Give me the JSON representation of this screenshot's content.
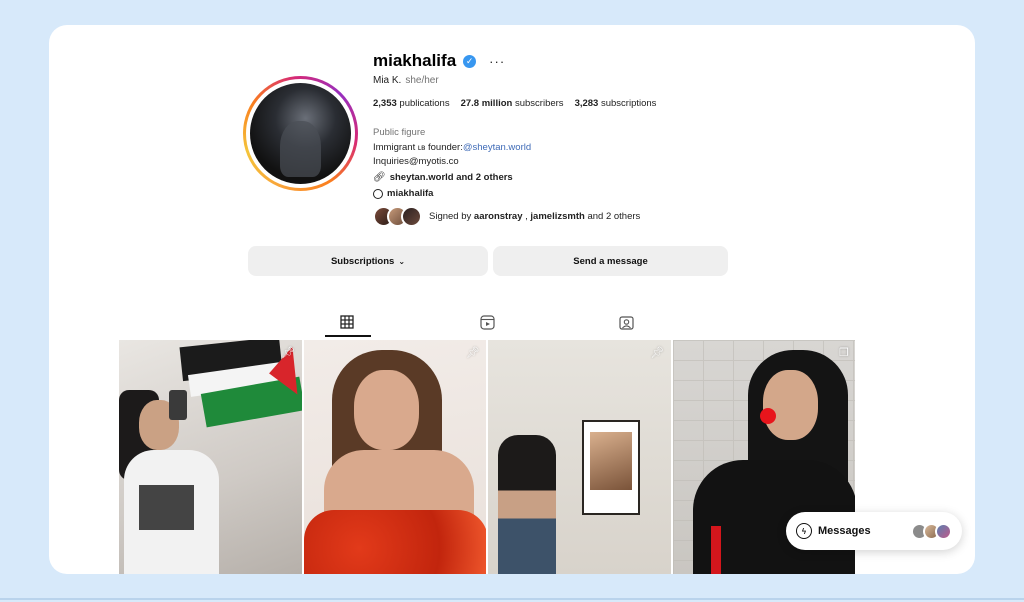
{
  "profile": {
    "username": "miakhalifa",
    "more": "···",
    "fullname": "Mia K.",
    "pronouns": "she/her",
    "stats": [
      {
        "value": "2,353",
        "label": "publications"
      },
      {
        "value": "27.8 million",
        "label": "subscribers"
      },
      {
        "value": "3,283",
        "label": "subscriptions"
      }
    ],
    "category": "Public figure",
    "bio_prefix": "Immigrant",
    "bio_flag": "ʟʙ",
    "bio_founder": "founder:",
    "bio_handle": "@sheytan.world",
    "bio_email": "Inquiries@myotis.co",
    "external_link": "sheytan.world and 2 others",
    "threads_handle": "miakhalifa",
    "signed_by_prefix": "Signed by",
    "signed_by_user1": "aaronstray",
    "signed_by_sep": ",",
    "signed_by_user2": "jamelizsmth",
    "signed_by_suffix": "and 2 others"
  },
  "buttons": {
    "subscriptions": "Subscriptions",
    "message": "Send a message"
  },
  "tabs": [
    {
      "name": "posts",
      "icon": "grid-icon",
      "active": true
    },
    {
      "name": "reels",
      "icon": "reels-icon",
      "active": false
    },
    {
      "name": "tagged",
      "icon": "tagged-icon",
      "active": false
    }
  ],
  "posts": [
    {
      "pinned": true,
      "icon": "pin-icon"
    },
    {
      "pinned": true,
      "icon": "pin-icon"
    },
    {
      "pinned": true,
      "icon": "pin-icon"
    },
    {
      "pinned": false,
      "icon": "carousel-icon"
    }
  ],
  "messages": {
    "label": "Messages"
  },
  "colors": {
    "page_bg": "#d7e9fa",
    "verified": "#3897f0",
    "link": "#3f6bb7",
    "button_bg": "#efefef"
  }
}
